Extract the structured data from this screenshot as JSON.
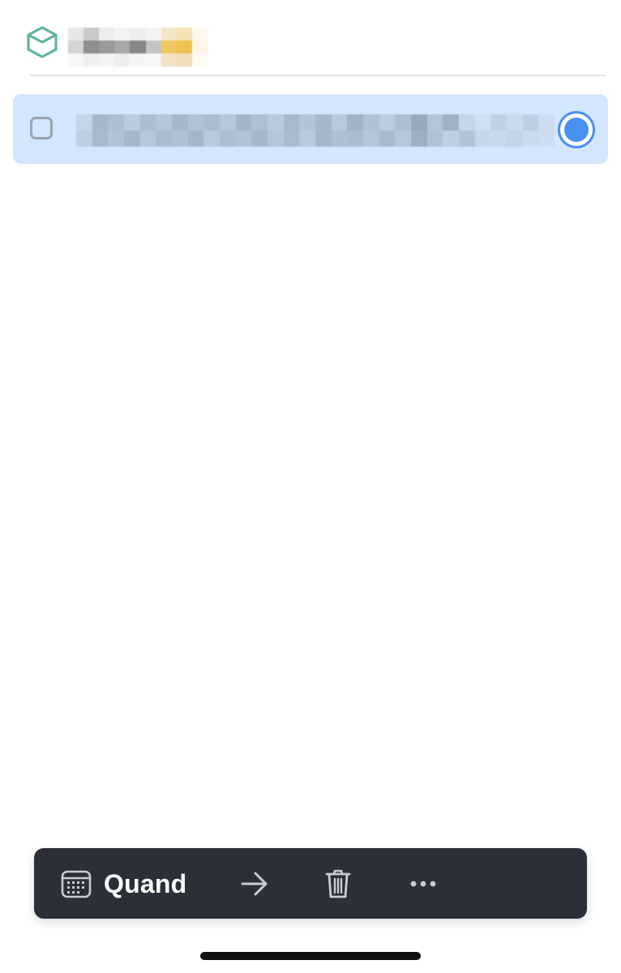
{
  "header": {
    "project_icon": "cube-icon",
    "project_title": "",
    "colors": {
      "icon": "#5fb598"
    }
  },
  "task": {
    "title": "",
    "checkbox_checked": false,
    "selected": true,
    "selection_color": "#d3e6fd",
    "radio_color": "#4a90f0"
  },
  "toolbar": {
    "when_icon": "calendar-icon",
    "when_label": "Quand",
    "move_icon": "arrow-right-icon",
    "delete_icon": "trash-icon",
    "more_icon": "more-horizontal-icon",
    "background": "#2a2f38"
  }
}
